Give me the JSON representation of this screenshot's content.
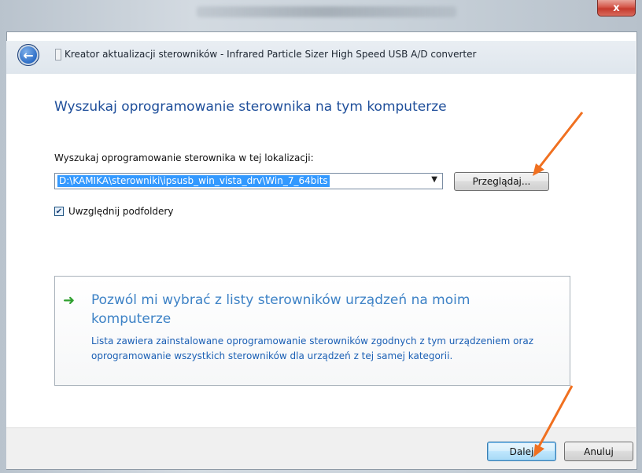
{
  "window": {
    "title": "Kreator aktualizacji sterowników - Infrared Particle Sizer High Speed USB A/D converter",
    "close_glyph": "x"
  },
  "page": {
    "heading": "Wyszukaj oprogramowanie sterownika na tym komputerze",
    "search_label": "Wyszukaj oprogramowanie sterownika w tej lokalizacji:",
    "path_value": "D:\\KAMIKA\\sterowniki\\ipsusb_win_vista_drv\\Win_7_64bits",
    "browse_label": "Przeglądaj...",
    "include_subfolders": {
      "label": "Uwzględnij podfoldery",
      "checked": true
    },
    "pick_option": {
      "title": "Pozwól mi wybrać z listy sterowników urządzeń na moim komputerze",
      "description": "Lista zawiera zainstalowane oprogramowanie sterowników zgodnych z tym urządzeniem oraz oprogramowanie wszystkich sterowników dla urządzeń z tej samej kategorii."
    }
  },
  "footer": {
    "next_label": "Dalej",
    "cancel_label": "Anuluj"
  },
  "colors": {
    "heading": "#1e4e9a",
    "link": "#3d82c6",
    "annotation_arrow": "#f07020",
    "selection": "#3399ff"
  },
  "icons": {
    "back": "back-arrow-icon",
    "app": "app-icon",
    "option": "green-arrow-icon",
    "combo": "chevron-down-icon"
  }
}
